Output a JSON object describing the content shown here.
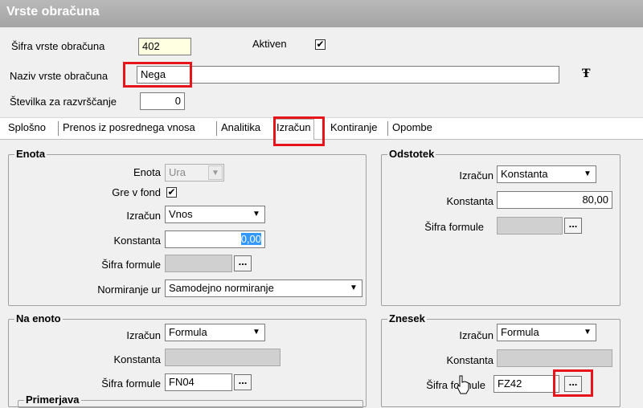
{
  "window": {
    "title": "Vrste obračuna"
  },
  "header": {
    "code_label": "Šifra vrste obračuna",
    "code_value": "402",
    "active_label": "Aktiven",
    "active_checked": "✔",
    "name_label": "Naziv vrste obračuna",
    "name_value": "Nega",
    "sort_label": "Številka za razvrščanje",
    "sort_value": "0",
    "font_icon": "font-icon"
  },
  "tabs": [
    {
      "label": "Splošno"
    },
    {
      "label": "Prenos iz posrednega vnosa"
    },
    {
      "label": "Analitika"
    },
    {
      "label": "Izračun"
    },
    {
      "label": "Kontiranje"
    },
    {
      "label": "Opombe"
    }
  ],
  "enota": {
    "title": "Enota",
    "unit_label": "Enota",
    "unit_value": "Ura",
    "fund_label": "Gre v fond",
    "fund_checked": "✔",
    "calc_label": "Izračun",
    "calc_value": "Vnos",
    "const_label": "Konstanta",
    "const_value": "0,00",
    "formula_label": "Šifra formule",
    "formula_value": "",
    "norm_label": "Normiranje ur",
    "norm_value": "Samodejno normiranje",
    "ellipsis": "..."
  },
  "odstotek": {
    "title": "Odstotek",
    "calc_label": "Izračun",
    "calc_value": "Konstanta",
    "const_label": "Konstanta",
    "const_value": "80,00",
    "formula_label": "Šifra formule",
    "formula_value": "",
    "ellipsis": "..."
  },
  "na_enoto": {
    "title": "Na enoto",
    "calc_label": "Izračun",
    "calc_value": "Formula",
    "const_label": "Konstanta",
    "const_value": "",
    "formula_label": "Šifra formule",
    "formula_value": "FN04",
    "ellipsis": "..."
  },
  "znesek": {
    "title": "Znesek",
    "calc_label": "Izračun",
    "calc_value": "Formula",
    "const_label": "Konstanta",
    "const_value": "",
    "formula_label": "Šifra formule",
    "formula_value": "FZ42",
    "ellipsis": "..."
  },
  "primerjava": {
    "title": "Primerjava"
  },
  "colors": {
    "highlight": "#e8141c",
    "title_bg": "#a8a8a8",
    "selection": "#3399ff"
  }
}
